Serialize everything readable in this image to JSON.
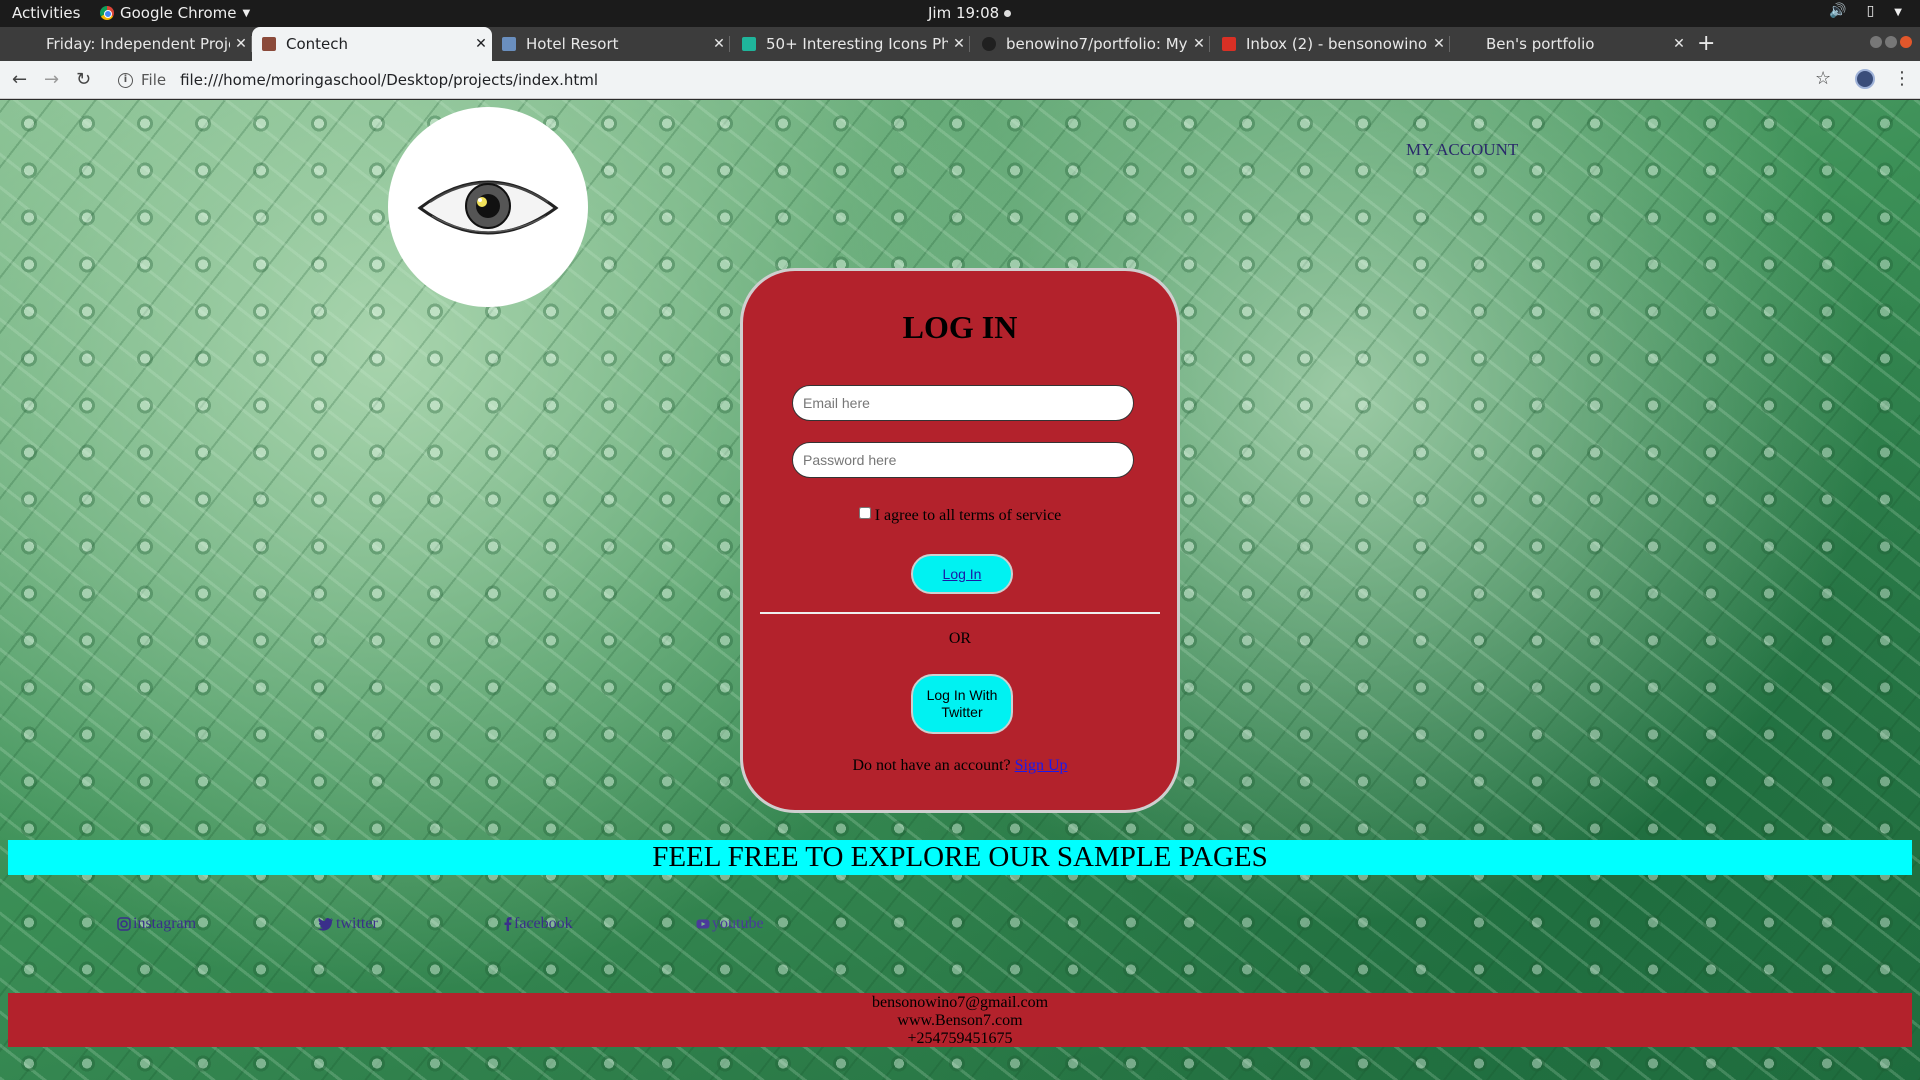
{
  "system": {
    "activities": "Activities",
    "app_name": "Google Chrome",
    "clock": "Jim 19:08"
  },
  "tabs": [
    {
      "title": "Friday: Independent Proje",
      "favicon_color": "#3c3c3c"
    },
    {
      "title": "Contech",
      "favicon_color": "#8b4a3a",
      "active": true
    },
    {
      "title": "Hotel Resort",
      "favicon_color": "#6a8fbf"
    },
    {
      "title": "50+ Interesting Icons Pho",
      "favicon_color": "#1fb59b"
    },
    {
      "title": "benowino7/portfolio: My",
      "favicon_color": "#202020"
    },
    {
      "title": "Inbox (2) - bensonowino7",
      "favicon_color": "#d93025"
    },
    {
      "title": "Ben's portfolio",
      "favicon_color": "#3c3c3c"
    }
  ],
  "address_bar": {
    "scheme_label": "File",
    "url": "file:///home/moringaschool/Desktop/projects/index.html"
  },
  "page": {
    "my_account": "MY ACCOUNT",
    "login": {
      "title": "LOG IN",
      "email_placeholder": "Email here",
      "password_placeholder": "Password here",
      "terms_label": "I agree to all terms of service",
      "login_button": "Log In",
      "or_text": "OR",
      "twitter_button": "Log In With Twitter",
      "no_account_text": "Do not have an account?",
      "signup_link": "Sign Up"
    },
    "banner": "FEEL FREE TO EXPLORE OUR SAMPLE PAGES",
    "social": {
      "instagram": "instagram",
      "twitter": "twitter",
      "facebook": "facebook",
      "youtube": "youtube"
    },
    "footer": {
      "email": "bensonowino7@gmail.com",
      "website": "www.Benson7.com",
      "phone": "+254759451675"
    }
  },
  "colors": {
    "card_red": "#b3222c",
    "cyan": "#00ffff",
    "link_blue": "#1a1aee",
    "social_purple": "#3a2f8a"
  }
}
